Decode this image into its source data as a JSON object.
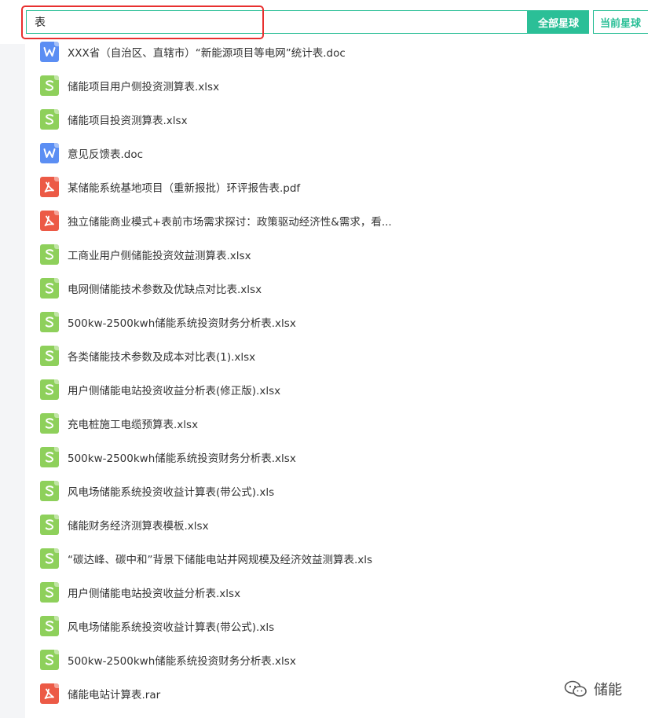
{
  "search": {
    "value": "表"
  },
  "buttons": {
    "all_planets": "全部星球",
    "current_planet": "当前星球"
  },
  "files": [
    {
      "type": "doc",
      "name": "XXX省（自治区、直辖市）“新能源项目等电网”统计表.doc"
    },
    {
      "type": "xlsx",
      "name": "储能项目用户侧投资测算表.xlsx"
    },
    {
      "type": "xlsx",
      "name": "储能项目投资测算表.xlsx"
    },
    {
      "type": "doc",
      "name": "意见反馈表.doc"
    },
    {
      "type": "pdf",
      "name": "某储能系统基地项目（重新报批）环评报告表.pdf"
    },
    {
      "type": "pdf",
      "name": "独立储能商业模式+表前市场需求探讨：政策驱动经济性&需求，看..."
    },
    {
      "type": "xlsx",
      "name": "工商业用户侧储能投资效益测算表.xlsx"
    },
    {
      "type": "xlsx",
      "name": "电网侧储能技术参数及优缺点对比表.xlsx"
    },
    {
      "type": "xlsx",
      "name": "500kw-2500kwh储能系统投资财务分析表.xlsx"
    },
    {
      "type": "xlsx",
      "name": "各类储能技术参数及成本对比表(1).xlsx"
    },
    {
      "type": "xlsx",
      "name": "用户侧储能电站投资收益分析表(修正版).xlsx"
    },
    {
      "type": "xlsx",
      "name": "充电桩施工电缆预算表.xlsx"
    },
    {
      "type": "xlsx",
      "name": "500kw-2500kwh储能系统投资财务分析表.xlsx"
    },
    {
      "type": "xlsx",
      "name": "风电场储能系统投资收益计算表(带公式).xls"
    },
    {
      "type": "xlsx",
      "name": "储能财务经济测算表模板.xlsx"
    },
    {
      "type": "xlsx",
      "name": "“碳达峰、碳中和”背景下储能电站并网规模及经济效益测算表.xls"
    },
    {
      "type": "xlsx",
      "name": "用户侧储能电站投资收益分析表.xlsx"
    },
    {
      "type": "xlsx",
      "name": "风电场储能系统投资收益计算表(带公式).xls"
    },
    {
      "type": "xlsx",
      "name": "500kw-2500kwh储能系统投资财务分析表.xlsx"
    },
    {
      "type": "pdf",
      "name": "储能电站计算表.rar"
    }
  ],
  "watermark": {
    "text": "储能"
  },
  "colors": {
    "accent": "#2bbf97",
    "highlight": "#e8302f",
    "xlsx": "#8ed05b",
    "doc": "#5b8ef3",
    "pdf": "#ec5a46"
  }
}
